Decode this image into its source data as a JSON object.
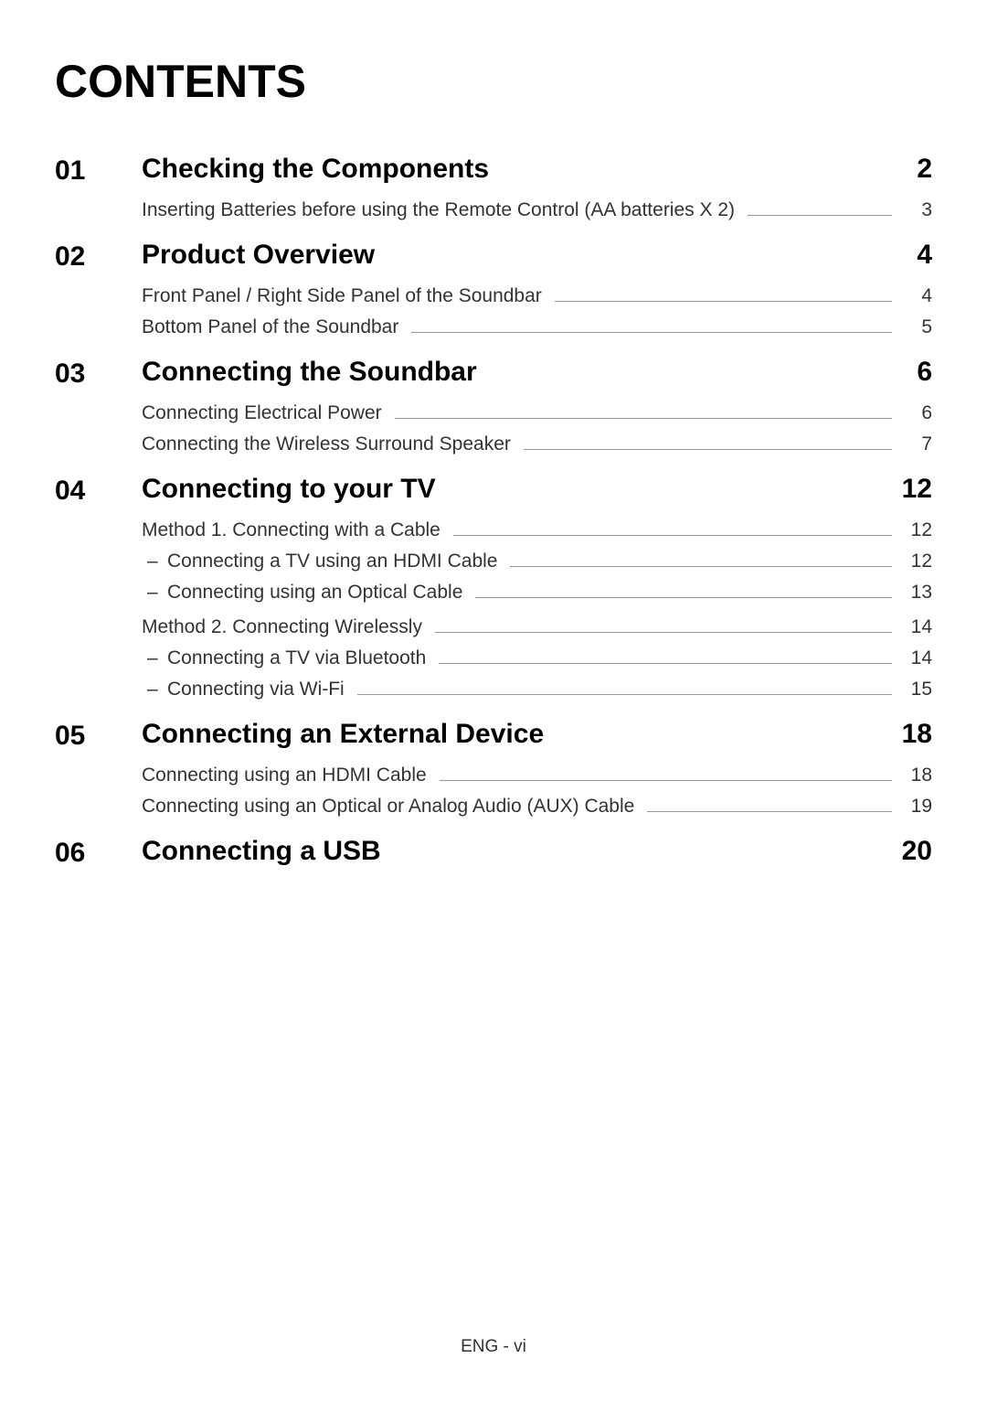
{
  "title": "CONTENTS",
  "footer": "ENG - vi",
  "sections": [
    {
      "num": "01",
      "title": "Checking the Components",
      "page": "2",
      "groups": [
        {
          "entries": [
            {
              "text": "Inserting Batteries before using the Remote Control (AA batteries X 2)",
              "page": "3",
              "sub": false
            }
          ]
        }
      ]
    },
    {
      "num": "02",
      "title": "Product Overview",
      "page": "4",
      "groups": [
        {
          "entries": [
            {
              "text": "Front Panel / Right Side Panel of the Soundbar",
              "page": "4",
              "sub": false
            },
            {
              "text": "Bottom Panel of the Soundbar",
              "page": "5",
              "sub": false
            }
          ]
        }
      ]
    },
    {
      "num": "03",
      "title": "Connecting the Soundbar",
      "page": "6",
      "groups": [
        {
          "entries": [
            {
              "text": "Connecting Electrical Power",
              "page": "6",
              "sub": false
            },
            {
              "text": "Connecting the Wireless Surround Speaker",
              "page": "7",
              "sub": false
            }
          ]
        }
      ]
    },
    {
      "num": "04",
      "title": "Connecting to your TV",
      "page": "12",
      "groups": [
        {
          "entries": [
            {
              "text": "Method 1. Connecting with a Cable",
              "page": "12",
              "sub": false
            },
            {
              "text": "Connecting a TV using an HDMI Cable",
              "page": "12",
              "sub": true
            },
            {
              "text": "Connecting using an Optical Cable",
              "page": "13",
              "sub": true
            }
          ]
        },
        {
          "entries": [
            {
              "text": "Method 2. Connecting Wirelessly",
              "page": "14",
              "sub": false
            },
            {
              "text": "Connecting a TV via Bluetooth",
              "page": "14",
              "sub": true
            },
            {
              "text": "Connecting via Wi-Fi",
              "page": "15",
              "sub": true
            }
          ]
        }
      ]
    },
    {
      "num": "05",
      "title": "Connecting an External Device",
      "page": "18",
      "groups": [
        {
          "entries": [
            {
              "text": "Connecting using an HDMI Cable",
              "page": "18",
              "sub": false
            },
            {
              "text": "Connecting using an Optical or Analog Audio (AUX) Cable",
              "page": "19",
              "sub": false
            }
          ]
        }
      ]
    },
    {
      "num": "06",
      "title": "Connecting a USB",
      "page": "20",
      "groups": []
    }
  ]
}
